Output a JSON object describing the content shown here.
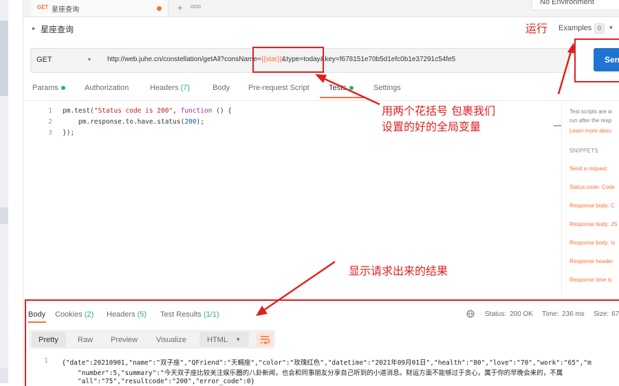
{
  "tab": {
    "method": "GET",
    "title": "星座查询",
    "more": "ooo",
    "new_tab": "+"
  },
  "environment": {
    "label": "No Environment"
  },
  "breadcrumb": {
    "caret": "▸",
    "title": "星座查询"
  },
  "examples": {
    "label": "Examples",
    "count": "0",
    "caret": "▾"
  },
  "request": {
    "method": "GET",
    "method_caret": "▾",
    "url_prefix": "http://web.juhe.cn/constellation/getAll?consName=",
    "url_var": "{{star}}",
    "url_suffix": "&type=today&key=f678151e70b5d1efc0b1e37291c54fe5",
    "send_label": "Send"
  },
  "request_tabs": {
    "params": "Params",
    "authorization": "Authorization",
    "headers": "Headers",
    "headers_count": "(7)",
    "body": "Body",
    "prerequest": "Pre-request Script",
    "tests": "Tests",
    "settings": "Settings"
  },
  "editor": {
    "line_numbers": [
      "1",
      "2",
      "3"
    ],
    "line1": {
      "fn": "pm.test(",
      "str": "\"Status code is 200\"",
      "mid": ", ",
      "kw": "function",
      "end": " () {"
    },
    "line2": {
      "pre": "    pm.response.to.have.status(",
      "num": "200",
      "end": ");"
    },
    "line3": "});"
  },
  "sidebar": {
    "desc1": "Test scripts are w",
    "desc2": "run after the resp",
    "learn_more": "Learn more abou",
    "snippets_title": "SNIPPETS",
    "snippets": [
      "Send a request",
      "Status code: Code",
      "Response body: C",
      "Response body: JS",
      "Response body: Is",
      "Response header",
      "Response time is"
    ]
  },
  "response_tabs": {
    "body": "Body",
    "cookies": "Cookies",
    "cookies_count": "(2)",
    "headers": "Headers",
    "headers_count": "(5)",
    "test_results": "Test Results",
    "test_results_count": "(1/1)"
  },
  "response_status": {
    "status_label": "Status:",
    "status_value": "200 OK",
    "time_label": "Time:",
    "time_value": "236 ms",
    "size_label": "Size:",
    "size_value": "67"
  },
  "format_bar": {
    "pretty": "Pretty",
    "raw": "Raw",
    "preview": "Preview",
    "visualize": "Visualize",
    "html": "HTML",
    "html_caret": "▾"
  },
  "response_body": {
    "line_number": "1",
    "line1": "{\"date\":20210901,\"name\":\"双子座\",\"QFriend\":\"天蝎座\",\"color\":\"玫瑰红色\",\"datetime\":\"2021年09月01日\",\"health\":\"80\",\"love\":\"70\",\"work\":\"65\",\"m",
    "line2": "    \"number\":5,\"summary\":\"今天双子座比较关注娱乐圈的八卦新闻，也会和同事朋友分享自己听到的小道消息。财运方面不能够过于贪心，属于你的早晚会来的，不属",
    "line3": "    \"all\":\"75\",\"resultcode\":\"200\",\"error_code\":0}"
  },
  "annotations": {
    "run": "运行",
    "var_line1": "用两个花括号 包裹我们",
    "var_line2": "设置的好的全局变量",
    "result": "显示请求出来的结果"
  },
  "colors": {
    "accent": "#ff6c37",
    "annotation": "#e02020",
    "send": "#1f74d1",
    "green": "#26b47f"
  }
}
